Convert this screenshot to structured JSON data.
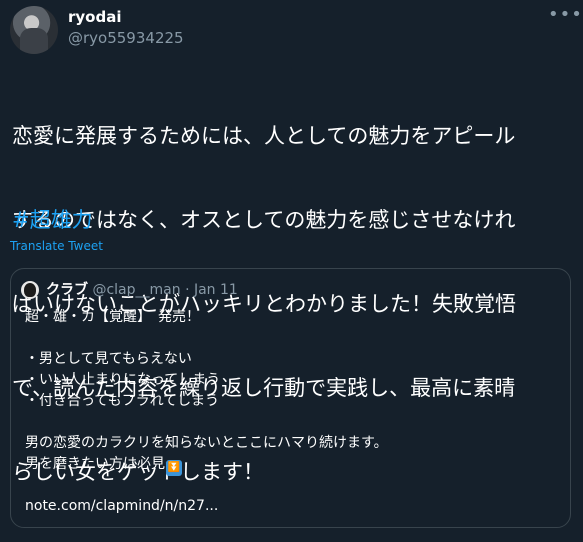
{
  "tweet": {
    "author_name": "ryodai",
    "author_handle": "@ryo55934225",
    "more_icon": "more-icon",
    "text_lines": [
      "恋愛に発展するためには、人としての魅力をアピール",
      "するのではなく、オスとしての魅力を感じさせなけれ",
      "ばいけないことがハッキリとわかりました！失敗覚悟",
      "で、読んだ内容を繰り返し行動で実践し、最高に素晴",
      "らしい女をゲットします！"
    ],
    "hashtag": "#超雄力",
    "translate_label": "Translate Tweet"
  },
  "quoted": {
    "author_name": "クラブ",
    "author_handle": "@clap__man",
    "separator": "·",
    "date": "Jan 11",
    "lines": [
      "超・雄・カ【覚醒】　発売！",
      "",
      "・男として見てもらえない",
      "・いい人止まりになってしまう",
      "・付き合ってもフラれてしまう",
      "",
      "男の恋愛のカラクリを知らないとここにハマり続けます。",
      "男を磨きたい方は必見",
      "",
      "note.com/clapmind/n/n27..."
    ],
    "emoji_icon": "double-down-arrow-emoji"
  },
  "colors": {
    "background": "#15202b",
    "accent": "#1da1f2",
    "secondary_text": "#8899a6",
    "border": "#38444d"
  }
}
